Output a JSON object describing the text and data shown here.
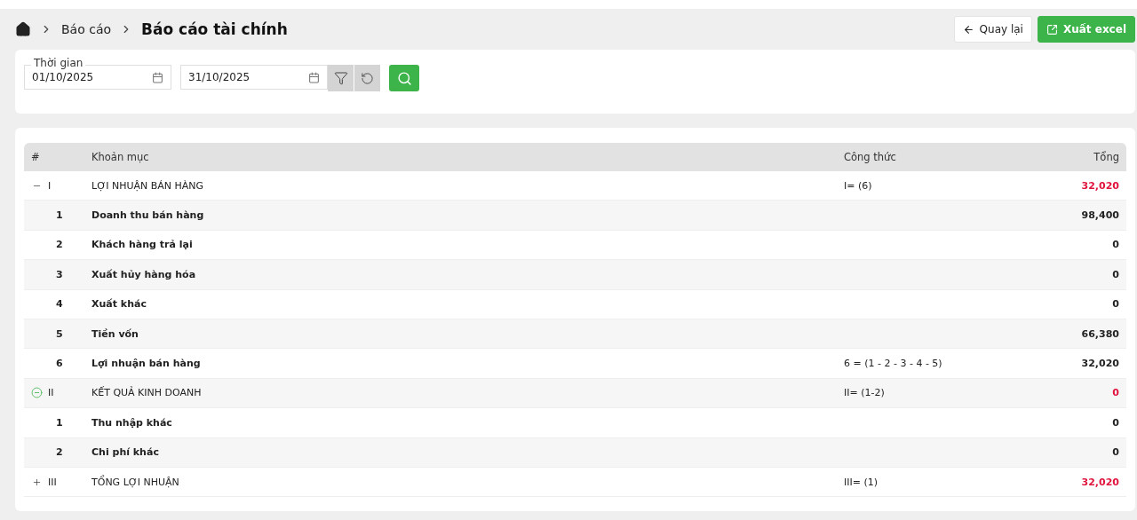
{
  "breadcrumb": {
    "items": [
      "Báo cáo"
    ],
    "current": "Báo cáo tài chính"
  },
  "actions": {
    "back": "Quay lại",
    "export": "Xuất excel"
  },
  "filter": {
    "label": "Thời gian",
    "from": "01/10/2025",
    "to": "31/10/2025"
  },
  "table": {
    "columns": [
      "#",
      "Khoản mục",
      "Công thức",
      "Tổng"
    ],
    "rows": [
      {
        "kind": "section",
        "index": "I",
        "name": "LỢI NHUẬN BÁN HÀNG",
        "formula": "I= (6)",
        "total": "32,020",
        "expanded": true,
        "focused": false,
        "children": [
          {
            "kind": "item",
            "index": "1",
            "name": "Doanh thu bán hàng",
            "total": "98,400"
          },
          {
            "kind": "item",
            "index": "2",
            "name": "Khách hàng trả lại",
            "total": "0"
          },
          {
            "kind": "item",
            "index": "3",
            "name": "Xuất hủy hàng hóa",
            "total": "0"
          },
          {
            "kind": "item",
            "index": "4",
            "name": "Xuất khác",
            "total": "0"
          },
          {
            "kind": "item",
            "index": "5",
            "name": "Tiền vốn",
            "total": "66,380"
          },
          {
            "kind": "item",
            "index": "6",
            "name": "Lợi nhuận bán hàng",
            "formula": "6 = (1 - 2 - 3 - 4 - 5)",
            "total": "32,020"
          }
        ]
      },
      {
        "kind": "section",
        "index": "II",
        "name": "KẾT QUẢ KINH DOANH",
        "formula": "II= (1-2)",
        "total": "0",
        "expanded": true,
        "focused": true,
        "children": [
          {
            "kind": "item",
            "index": "1",
            "name": "Thu nhập khác",
            "total": "0"
          },
          {
            "kind": "item",
            "index": "2",
            "name": "Chi phí khác",
            "total": "0"
          }
        ]
      },
      {
        "kind": "section",
        "index": "III",
        "name": "TỔNG LỢI NHUẬN",
        "formula": "III= (1)",
        "total": "32,020",
        "expanded": false,
        "focused": false
      }
    ]
  }
}
